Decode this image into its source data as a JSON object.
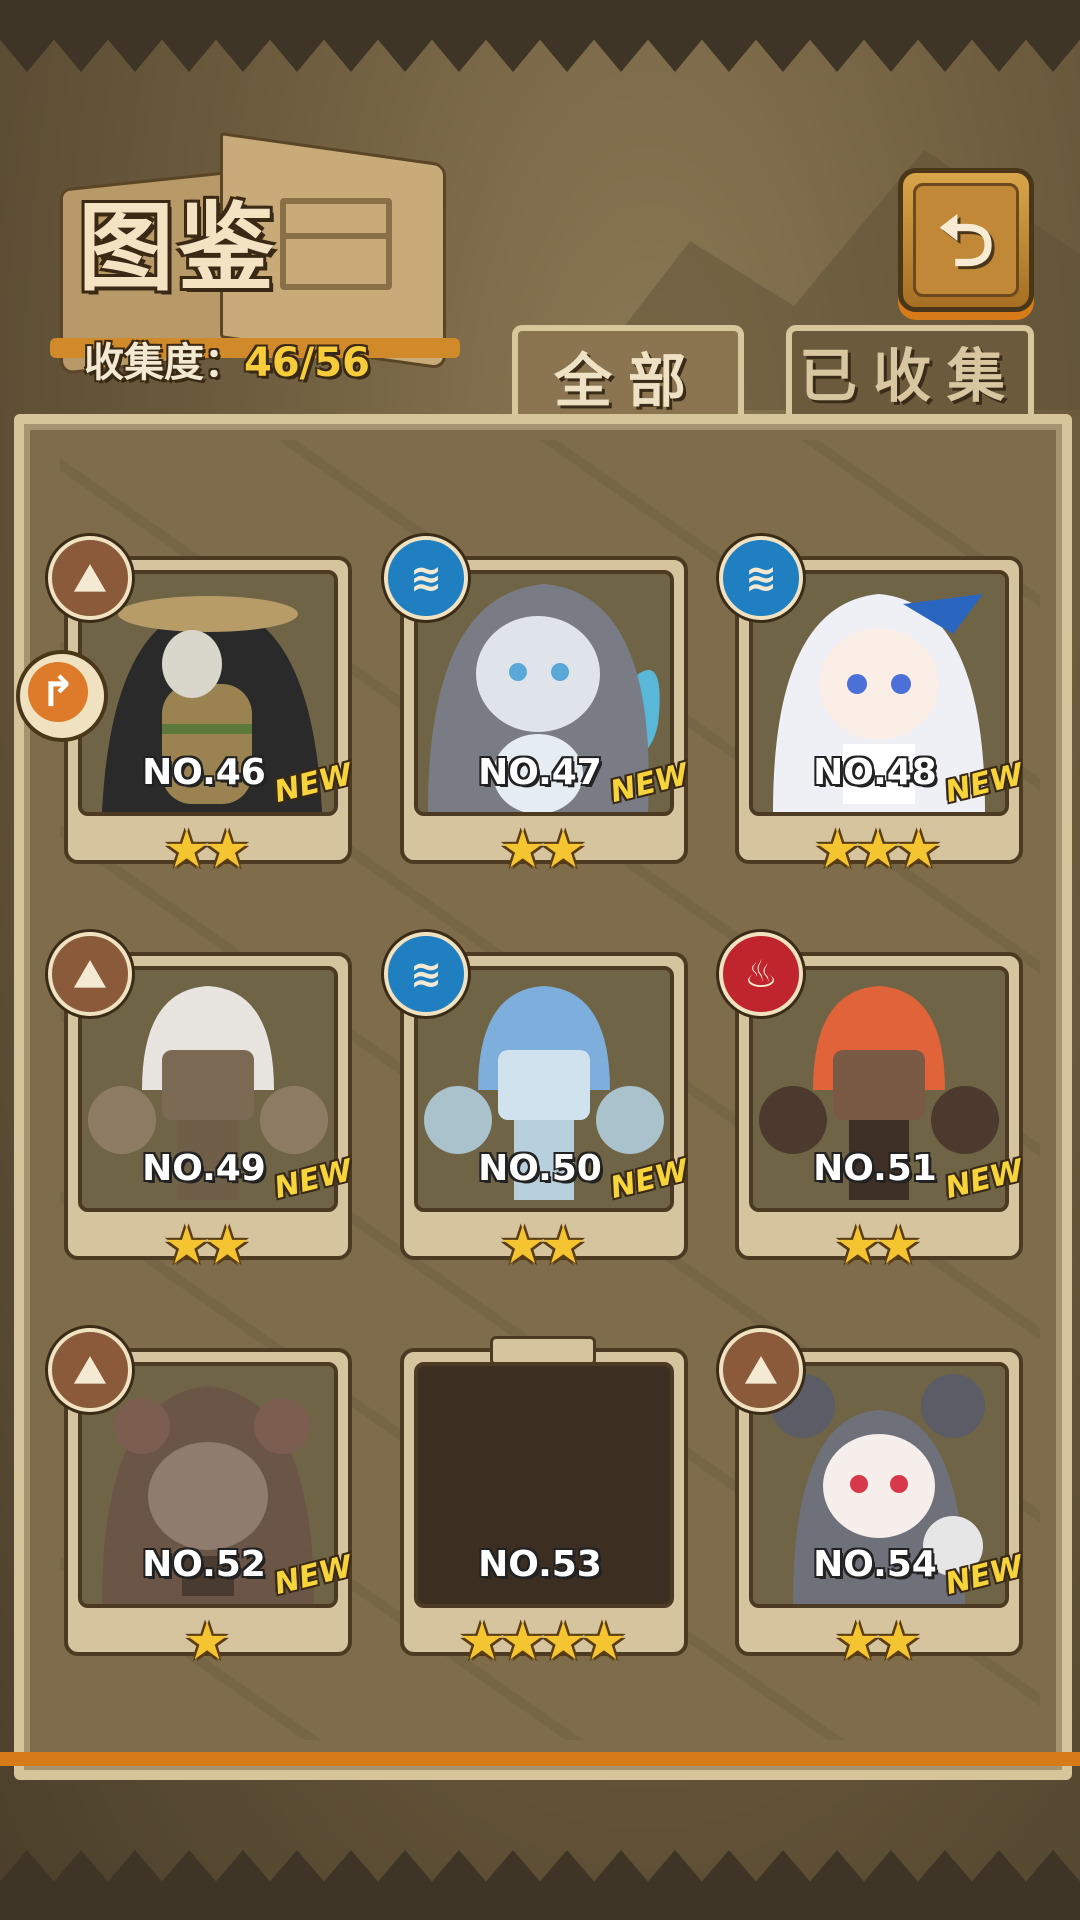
{
  "header": {
    "title": "图鉴",
    "collection_label": "收集度：",
    "collection_value": "46/56",
    "back_icon": "return-icon"
  },
  "tabs": [
    {
      "label": "全部",
      "active": true
    },
    {
      "label": "已收集",
      "active": false
    }
  ],
  "colors": {
    "accent_orange": "#d67b17",
    "collection_value": "#f7cc3a",
    "element_earth": "#8a5a3a",
    "element_water": "#1f7fc0",
    "element_fire": "#c0242c"
  },
  "cards": [
    {
      "number": "NO.46",
      "stars": "★★",
      "badge": "NEW",
      "element": "earth-icon"
    },
    {
      "number": "NO.47",
      "stars": "★★",
      "badge": "NEW",
      "element": "water-icon"
    },
    {
      "number": "NO.48",
      "stars": "★★★",
      "badge": "NEW",
      "element": "water-icon"
    },
    {
      "number": "NO.49",
      "stars": "★★",
      "badge": "NEW",
      "element": "earth-icon"
    },
    {
      "number": "NO.50",
      "stars": "★★",
      "badge": "NEW",
      "element": "water-icon"
    },
    {
      "number": "NO.51",
      "stars": "★★",
      "badge": "NEW",
      "element": "fire-icon"
    },
    {
      "number": "NO.52",
      "stars": "★",
      "badge": "NEW",
      "element": "earth-icon"
    },
    {
      "number": "NO.53",
      "stars": "★★★★",
      "badge": "",
      "element": "",
      "locked": true
    },
    {
      "number": "NO.54",
      "stars": "★★",
      "badge": "NEW",
      "element": "earth-icon"
    }
  ]
}
